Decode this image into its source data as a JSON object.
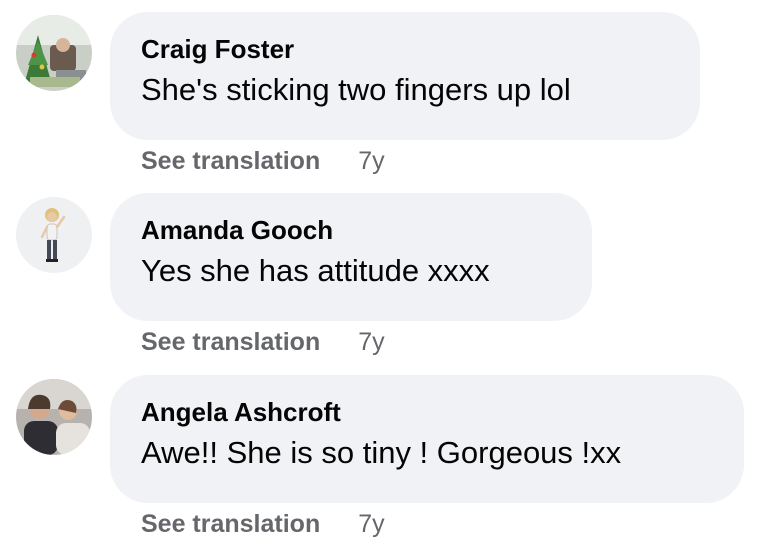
{
  "comments": [
    {
      "author": "Craig Foster",
      "text": "She's sticking two fingers up lol",
      "action": "See translation",
      "time": "7y",
      "avatar": "craig-foster-avatar"
    },
    {
      "author": "Amanda Gooch",
      "text": "Yes she has attitude xxxx",
      "action": "See translation",
      "time": "7y",
      "avatar": "amanda-gooch-avatar"
    },
    {
      "author": "Angela Ashcroft",
      "text": "Awe!! She is so tiny ! Gorgeous !xx",
      "action": "See translation",
      "time": "7y",
      "avatar": "angela-ashcroft-avatar"
    }
  ],
  "colors": {
    "bubble": "#f0f2f5",
    "name": "#050505",
    "meta": "#65676b"
  }
}
